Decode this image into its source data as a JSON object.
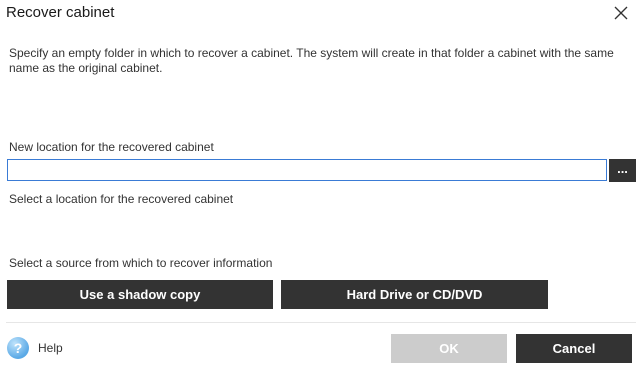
{
  "window": {
    "title": "Recover cabinet",
    "close_icon": "close-icon"
  },
  "description": "Specify an empty  folder in which to recover a cabinet.  The system will create in that folder a cabinet with the same name as the original cabinet.",
  "location": {
    "label": "New location for the recovered cabinet",
    "value": "",
    "browse_label": "...",
    "helper": "Select a location for the recovered cabinet"
  },
  "source": {
    "label": "Select a source from which to recover information",
    "shadow_copy_label": "Use a shadow copy",
    "hard_drive_label": "Hard Drive or CD/DVD"
  },
  "footer": {
    "help_icon": "help-icon",
    "help_label": "Help",
    "ok_label": "OK",
    "ok_enabled": false,
    "cancel_label": "Cancel"
  },
  "colors": {
    "button_dark": "#333333",
    "button_disabled": "#cccccc",
    "input_focus_border": "#3a7bd5",
    "help_icon": "#5aa9e6"
  }
}
